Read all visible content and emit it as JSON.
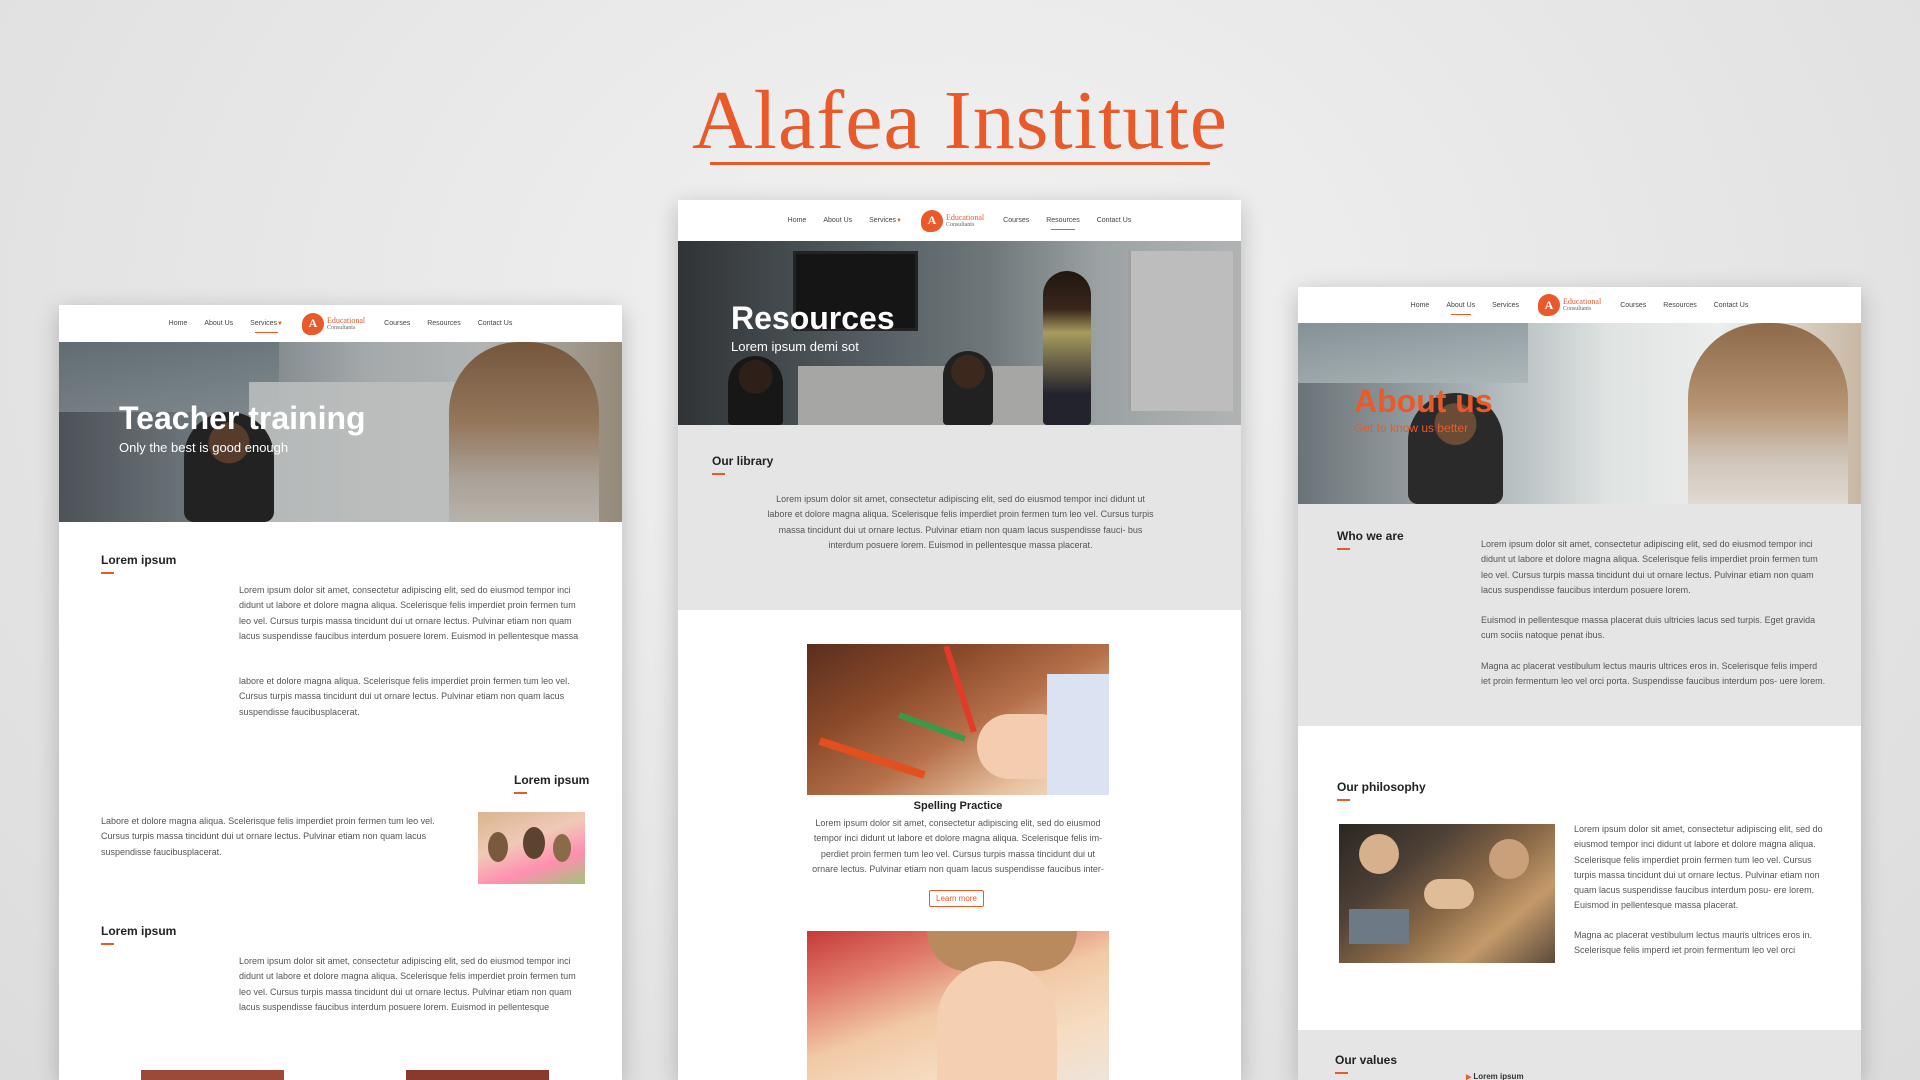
{
  "page_title": "Alafea Institute",
  "accent": "#e95a2b",
  "logo": {
    "line1": "Educational",
    "line2": "Consultants",
    "mark": "A"
  },
  "nav": {
    "home": "Home",
    "about": "About Us",
    "services": "Services",
    "courses": "Courses",
    "resources": "Resources",
    "contact": "Contact Us"
  },
  "left": {
    "hero_title": "Teacher training",
    "hero_sub": "Only the best is good enough",
    "s1_title": "Lorem ipsum",
    "s1_p1": "Lorem ipsum dolor sit amet, consectetur adipiscing elit, sed do eiusmod tempor inci didunt ut labore et dolore magna aliqua. Scelerisque felis imperdiet proin fermen tum leo vel. Cursus turpis massa tincidunt dui ut ornare lectus. Pulvinar etiam non quam lacus suspendisse faucibus interdum posuere lorem. Euismod in pellentesque massa",
    "s1_p2": "labore et dolore magna aliqua. Scelerisque felis imperdiet proin fermen tum leo vel. Cursus turpis massa tincidunt dui ut ornare lectus. Pulvinar etiam non quam lacus suspendisse faucibusplacerat.",
    "s2_title": "Lorem ipsum",
    "s2_p": "Labore et dolore magna aliqua. Scelerisque felis imperdiet proin fermen tum leo vel. Cursus turpis massa tincidunt dui ut ornare lectus. Pulvinar etiam non quam lacus suspendisse faucibusplacerat.",
    "s3_title": "Lorem ipsum",
    "s3_p": "Lorem ipsum dolor sit amet, consectetur adipiscing elit, sed do eiusmod tempor inci didunt ut labore et dolore magna aliqua. Scelerisque felis imperdiet proin fermen tum leo vel. Cursus turpis massa tincidunt dui ut ornare lectus. Pulvinar etiam non quam lacus suspendisse faucibus interdum posuere lorem. Euismod in pellentesque"
  },
  "center": {
    "hero_title": "Resources",
    "hero_sub": "Lorem ipsum demi sot",
    "lib_title": "Our library",
    "lib_p": "Lorem ipsum dolor sit amet, consectetur adipiscing elit, sed do eiusmod tempor inci didunt ut labore et dolore magna aliqua. Scelerisque felis imperdiet proin fermen tum leo vel. Cursus turpis massa tincidunt dui ut ornare lectus. Pulvinar etiam non quam lacus suspendisse fauci- bus interdum posuere lorem. Euismod in pellentesque massa placerat.",
    "card_title": "Spelling Practice",
    "card_p": "Lorem ipsum dolor sit amet, consectetur adipiscing elit, sed do eiusmod tempor inci didunt ut labore et dolore magna aliqua. Scelerisque felis im- perdiet proin fermen tum leo vel. Cursus turpis massa tincidunt dui ut ornare lectus. Pulvinar etiam non quam lacus suspendisse faucibus inter-",
    "learn_more": "Learn more"
  },
  "right": {
    "hero_title": "About us",
    "hero_sub": "Get to know us better",
    "who_title": "Who we are",
    "who_p1": "Lorem ipsum dolor sit amet, consectetur adipiscing elit, sed do eiusmod tempor inci didunt ut labore et dolore magna aliqua. Scelerisque felis imperdiet proin fermen tum leo vel. Cursus turpis massa tincidunt dui ut ornare lectus. Pulvinar etiam non quam lacus suspendisse faucibus interdum posuere lorem.",
    "who_p2": "Euismod in pellentesque massa placerat duis ultricies lacus sed turpis. Eget gravida cum sociis natoque penat ibus.",
    "who_p3": "Magna ac placerat vestibulum lectus mauris ultrices eros in. Scelerisque felis imperd iet proin fermentum leo vel orci porta. Suspendisse faucibus interdum pos- uere lorem.",
    "phil_title": "Our philosophy",
    "phil_p1": "Lorem ipsum dolor sit amet, consectetur adipiscing elit, sed do eiusmod tempor inci didunt ut labore et dolore magna aliqua. Scelerisque felis imperdiet proin fermen tum leo vel. Cursus turpis massa tincidunt dui ut ornare lectus. Pulvinar etiam non quam lacus suspendisse faucibus interdum posu- ere lorem. Euismod in pellentesque massa placerat.",
    "phil_p2": "Magna ac placerat vestibulum lectus mauris ultrices eros in. Scelerisque felis imperd iet proin fermentum leo vel orci",
    "values_title": "Our values",
    "values_item": "Lorem ipsum"
  }
}
